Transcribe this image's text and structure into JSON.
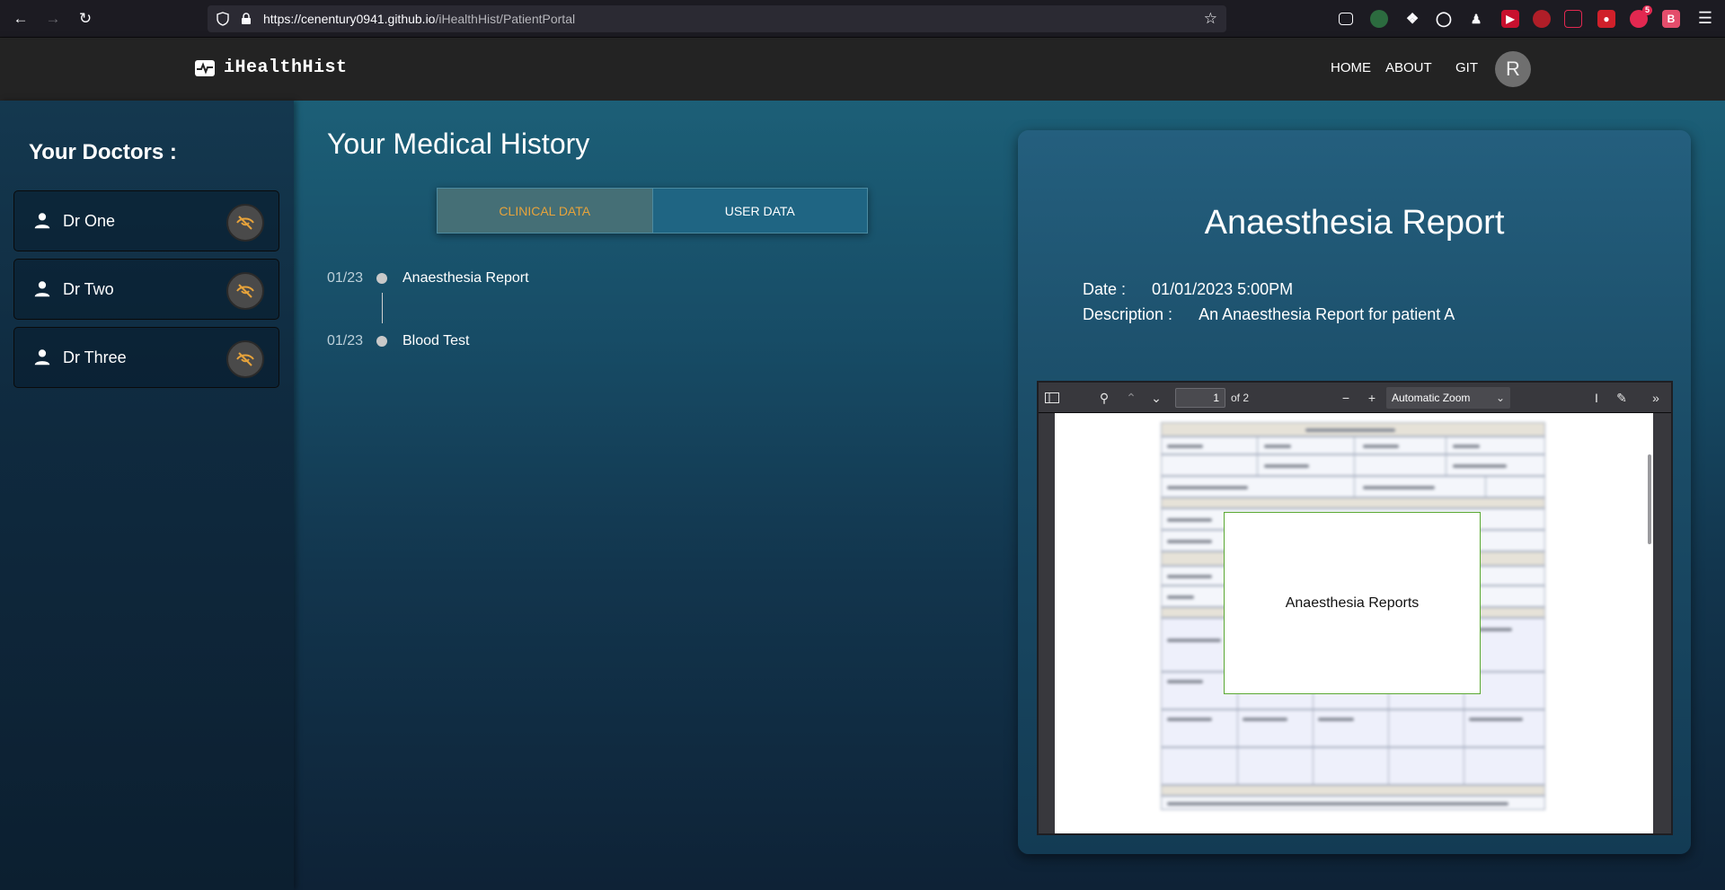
{
  "browser": {
    "url_host": "https://cenentury0941.github.io",
    "url_path": "/iHealthHist/PatientPortal",
    "extension_badge": "5",
    "extension_b_label": "B"
  },
  "header": {
    "brand": "iHealthHist",
    "nav": {
      "home": "HOME",
      "about": "ABOUT",
      "git": "GIT"
    },
    "avatar_initial": "R"
  },
  "sidebar": {
    "title": "Your Doctors :",
    "doctors": [
      {
        "name": "Dr One"
      },
      {
        "name": "Dr Two"
      },
      {
        "name": "Dr Three"
      }
    ]
  },
  "main": {
    "title": "Your Medical History",
    "tabs": {
      "clinical": "CLINICAL DATA",
      "user": "USER DATA"
    },
    "timeline": [
      {
        "date": "01/23",
        "label": "Anaesthesia Report"
      },
      {
        "date": "01/23",
        "label": "Blood Test"
      }
    ]
  },
  "report": {
    "title": "Anaesthesia Report",
    "date_label": "Date :",
    "date_value": "01/01/2023 5:00PM",
    "description_label": "Description :",
    "description_value": "An Anaesthesia Report for patient A"
  },
  "pdf": {
    "page_number": "1",
    "page_total": "of 2",
    "zoom": "Automatic Zoom",
    "overlay_text": "Anaesthesia Reports"
  },
  "colors": {
    "accent_orange": "#e7a33b",
    "tab_active_bg": "#456f76",
    "tab_inactive_bg": "#1f6583"
  }
}
